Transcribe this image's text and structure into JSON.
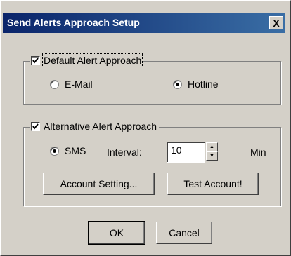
{
  "window": {
    "title": "Send Alerts Approach Setup",
    "close_label": "X"
  },
  "default_group": {
    "label": "Default Alert Approach",
    "checked": true,
    "options": [
      {
        "label": "E-Mail",
        "selected": false
      },
      {
        "label": "Hotline",
        "selected": true
      }
    ]
  },
  "alt_group": {
    "label": "Alternative Alert Approach",
    "checked": true,
    "sms_label": "SMS",
    "sms_selected": true,
    "interval_label": "Interval:",
    "interval_value": "10",
    "unit_label": "Min",
    "account_setting_label": "Account Setting...",
    "test_account_label": "Test Account!"
  },
  "buttons": {
    "ok": "OK",
    "cancel": "Cancel"
  },
  "colors": {
    "titlebar_start": "#0a246a",
    "titlebar_end": "#3a6ea5",
    "face": "#d4d0c8"
  }
}
